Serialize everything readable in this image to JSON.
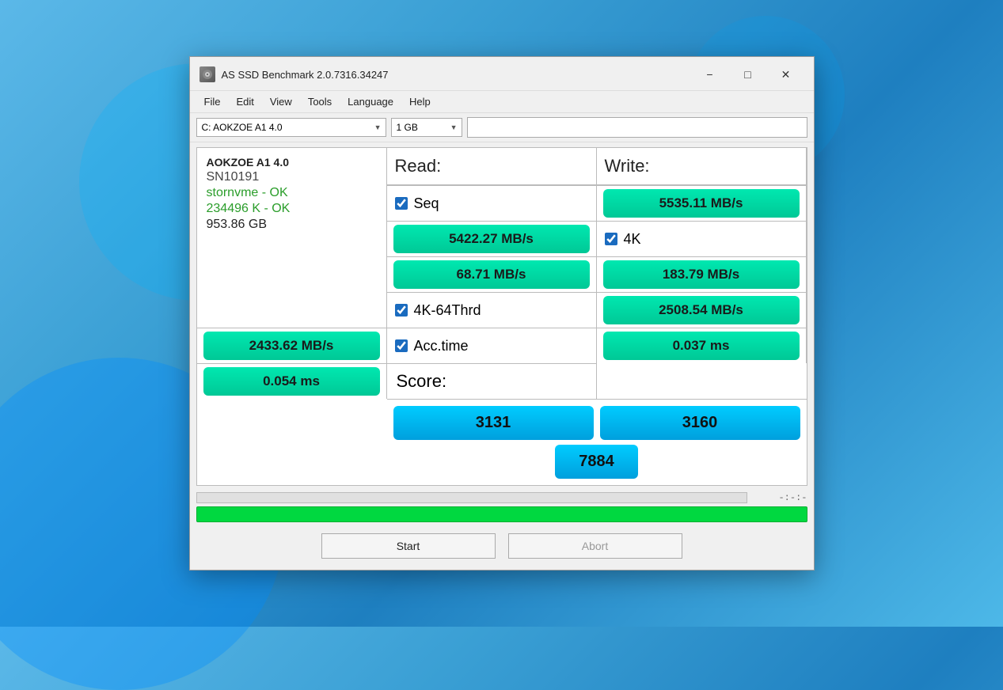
{
  "window": {
    "title": "AS SSD Benchmark 2.0.7316.34247",
    "icon": "💿"
  },
  "menubar": {
    "items": [
      "File",
      "Edit",
      "View",
      "Tools",
      "Language",
      "Help"
    ]
  },
  "toolbar": {
    "drive_label": "C: AOKZOE A1 4.0",
    "size_label": "1 GB",
    "text_placeholder": ""
  },
  "drive_info": {
    "name": "AOKZOE A1 4.0",
    "sn": "SN10191",
    "driver": "stornvme - OK",
    "size_k": "234496 K - OK",
    "size_gb": "953.86 GB"
  },
  "columns": {
    "read": "Read:",
    "write": "Write:"
  },
  "rows": [
    {
      "label": "Seq",
      "read": "5535.11 MB/s",
      "write": "5422.27 MB/s",
      "checked": true
    },
    {
      "label": "4K",
      "read": "68.71 MB/s",
      "write": "183.79 MB/s",
      "checked": true
    },
    {
      "label": "4K-64Thrd",
      "read": "2508.54 MB/s",
      "write": "2433.62 MB/s",
      "checked": true
    },
    {
      "label": "Acc.time",
      "read": "0.037 ms",
      "write": "0.054 ms",
      "checked": true
    }
  ],
  "score": {
    "label": "Score:",
    "read": "3131",
    "write": "3160",
    "total": "7884"
  },
  "progress": {
    "time_display": "-:-:-",
    "bar_percent": 100
  },
  "buttons": {
    "start": "Start",
    "abort": "Abort"
  }
}
